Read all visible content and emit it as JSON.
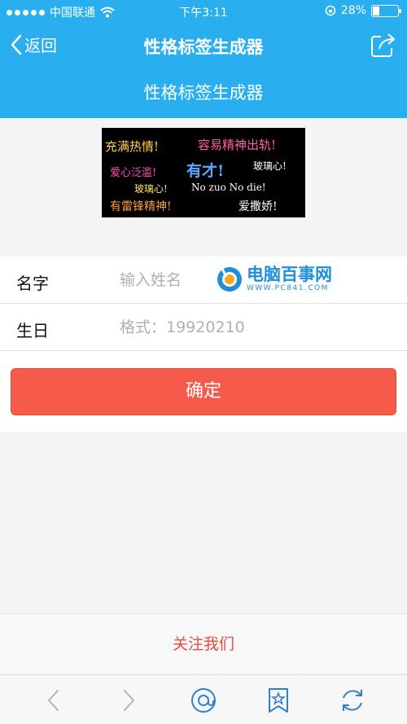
{
  "status_bar": {
    "carrier": "中国联通",
    "time": "下午3:11",
    "battery": "28%",
    "battery_level": 0.28
  },
  "nav": {
    "back_label": "返回",
    "title": "性格标签生成器"
  },
  "header": {
    "title": "性格标签生成器"
  },
  "banner": {
    "phrases": [
      "充满热情!",
      "容易精神出轨!",
      "爱心泛滥!",
      "有才!",
      "玻璃心!",
      "玻璃心!",
      "No zuo No die!",
      "有雷锋精神!",
      "爱撒娇!"
    ]
  },
  "form": {
    "name_label": "名字",
    "name_placeholder": "输入姓名",
    "birthday_label": "生日",
    "birthday_placeholder": "格式：19920210"
  },
  "watermark": {
    "text": "电脑百事网",
    "url": "WWW.PC841.COM"
  },
  "confirm_button": "确定",
  "follow_link": "关注我们",
  "colors": {
    "accent": "#29aef0",
    "button": "#f55a4b",
    "link": "#e94b3c"
  },
  "toolbar": {
    "icons": [
      "back-arrow-icon",
      "forward-arrow-icon",
      "at-icon",
      "bookmark-star-icon",
      "refresh-icon"
    ]
  }
}
